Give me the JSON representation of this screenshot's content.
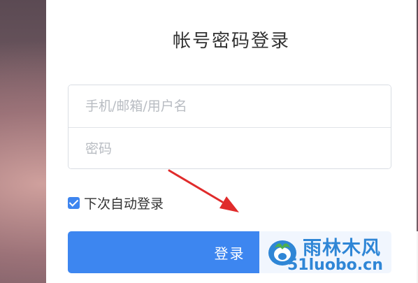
{
  "login": {
    "title": "帐号密码登录",
    "username_placeholder": "手机/邮箱/用户名",
    "password_placeholder": "密码",
    "remember_label": "下次自动登录",
    "remember_checked": true,
    "submit_label": "登录"
  },
  "watermark": {
    "name": "雨林木风",
    "url": "51luobo.cn"
  },
  "colors": {
    "accent": "#3d86f0",
    "annotation_arrow": "#e02b2b",
    "watermark": "#2f86d6"
  }
}
